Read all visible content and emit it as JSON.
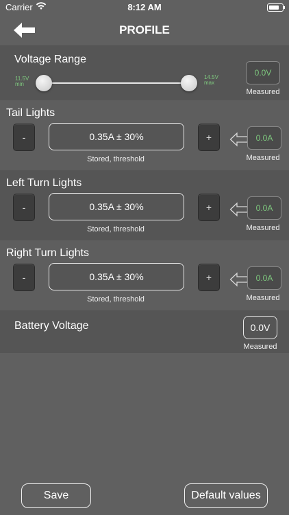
{
  "status_bar": {
    "carrier": "Carrier",
    "time": "8:12 AM"
  },
  "nav": {
    "title": "PROFILE",
    "back_icon": "back-arrow-icon"
  },
  "voltage_range": {
    "title": "Voltage Range",
    "min_value": "11.5V",
    "min_label": "min",
    "max_value": "14.5V",
    "max_label": "max",
    "measured_value": "0.0V",
    "measured_label": "Measured",
    "slider_min_fraction": 0.0,
    "slider_max_fraction": 1.0
  },
  "tail_lights": {
    "title": "Tail Lights",
    "minus": "-",
    "plus": "+",
    "value": "0.35A  ±  30%",
    "stored_label": "Stored, threshold",
    "measured_value": "0.0A",
    "measured_label": "Measured"
  },
  "left_turn": {
    "title": "Left Turn Lights",
    "minus": "-",
    "plus": "+",
    "value": "0.35A  ±  30%",
    "stored_label": "Stored, threshold",
    "measured_value": "0.0A",
    "measured_label": "Measured"
  },
  "right_turn": {
    "title": "Right Turn Lights",
    "minus": "-",
    "plus": "+",
    "value": "0.35A  ±  30%",
    "stored_label": "Stored, threshold",
    "measured_value": "0.0A",
    "measured_label": "Measured"
  },
  "battery": {
    "title": "Battery Voltage",
    "measured_value": "0.0V",
    "measured_label": "Measured"
  },
  "footer": {
    "save_label": "Save",
    "defaults_label": "Default values"
  },
  "colors": {
    "background": "#606060",
    "measured_text": "#7ec87e",
    "section_dark": "#555555"
  }
}
